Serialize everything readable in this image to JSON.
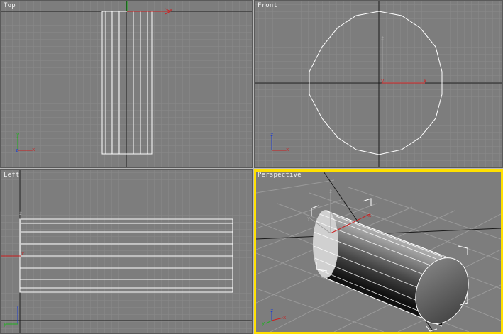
{
  "viewports": {
    "top": {
      "label": "Top"
    },
    "front": {
      "label": "Front"
    },
    "left": {
      "label": "Left"
    },
    "perspective": {
      "label": "Perspective",
      "active": true
    }
  },
  "axes": {
    "x": "x",
    "y": "y",
    "z": "z"
  },
  "colors": {
    "viewport_bg": "#7d7d7d",
    "grid_minor": "#888888",
    "grid_major": "#1a1a1a",
    "wireframe": "#ffffff",
    "gizmo_x": "#cc2020",
    "gizmo_y": "#20b020",
    "gizmo_z": "#2040d0",
    "active_border": "#ffe000"
  }
}
